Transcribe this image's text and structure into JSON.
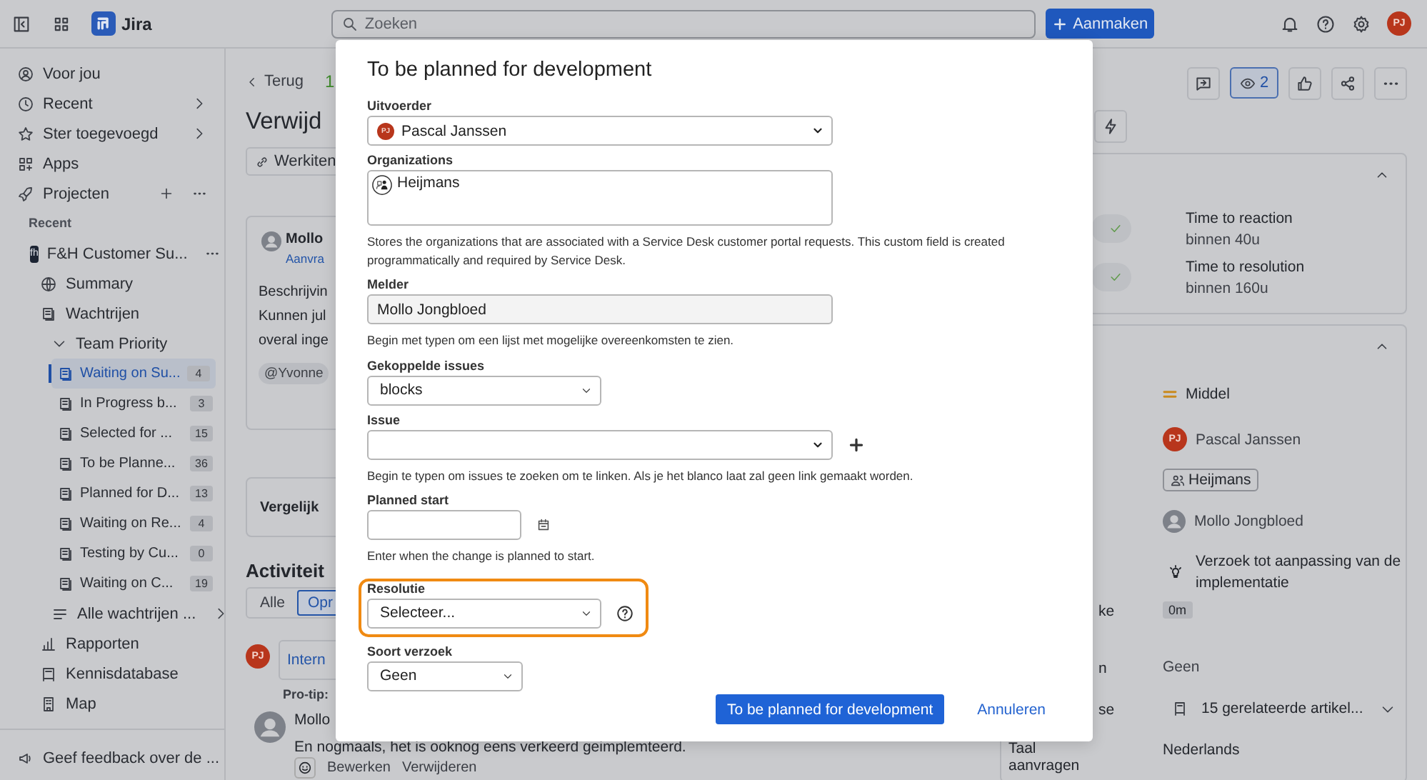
{
  "topbar": {
    "app_name": "Jira",
    "search": {
      "placeholder": "Zoeken"
    },
    "create_button": "Aanmaken",
    "avatar": "PJ"
  },
  "sidebar": {
    "top_items": [
      {
        "label": "Voor jou",
        "expandable": false
      },
      {
        "label": "Recent",
        "expandable": true
      },
      {
        "label": "Ster toegevoegd",
        "expandable": true
      },
      {
        "label": "Apps",
        "expandable": false
      }
    ],
    "projects": "Projecten",
    "section_label": "Recent",
    "project": {
      "logo": "fh",
      "name": "F&H Customer Su...",
      "children": [
        {
          "label": "Summary"
        },
        {
          "label": "Wachtrijen",
          "children": [
            {
              "label": "Team Priority",
              "expanded": true,
              "children": [
                {
                  "label": "Waiting on Su...",
                  "count": "4",
                  "selected": true
                },
                {
                  "label": "In Progress b...",
                  "count": "3",
                  "selected": false
                },
                {
                  "label": "Selected for ...",
                  "count": "15",
                  "selected": false
                },
                {
                  "label": "To be Planne...",
                  "count": "36",
                  "selected": false
                },
                {
                  "label": "Planned for D...",
                  "count": "13",
                  "selected": false
                },
                {
                  "label": "Waiting on Re...",
                  "count": "4",
                  "selected": false
                },
                {
                  "label": "Testing by Cu...",
                  "count": "0",
                  "selected": false
                },
                {
                  "label": "Waiting on C...",
                  "count": "19",
                  "selected": false
                }
              ]
            },
            {
              "label": "Alle wachtrijen ...",
              "expandable": true
            }
          ]
        },
        {
          "label": "Rapporten"
        },
        {
          "label": "Kennisdatabase"
        },
        {
          "label": "Map"
        }
      ]
    },
    "feedback": "Geef feedback over de ..."
  },
  "issue": {
    "back": "Terug",
    "status_fragment": "1",
    "title": "Verwijd",
    "link_button": "Werkiten",
    "description_card": {
      "author": "Mollo",
      "author_sub": "Aanvra",
      "heading": "Beschrijvin",
      "lines": [
        "Kunnen jul",
        "overal inge"
      ],
      "mention": "@Yvonne"
    },
    "similar_card": "Vergelijk",
    "activity": {
      "title": "Activiteit",
      "tabs": [
        {
          "label": "Alle",
          "selected": false
        },
        {
          "label": "Opr",
          "selected": true
        }
      ],
      "avatar": "PJ",
      "internal_note": "Intern",
      "protip": "Pro-tip:",
      "comments": [
        {
          "author": "Mollo",
          "text": "En nogmaals, het is ooknog eens verkeerd geimplemteerd.",
          "actions": [
            "Bewerken",
            "Verwijderen"
          ]
        }
      ]
    }
  },
  "details": {
    "watchers": "2",
    "sla": [
      {
        "name": "Time to reaction",
        "value": "binnen 40u"
      },
      {
        "name": "Time to resolution",
        "value": "binnen 160u"
      }
    ],
    "fields": [
      {
        "kind": "priority",
        "value": "Middel"
      },
      {
        "kind": "user",
        "avatar": "PJ",
        "value": "Pascal Janssen"
      },
      {
        "kind": "org",
        "value": "Heijmans"
      },
      {
        "kind": "person",
        "value": "Mollo Jongbloed"
      },
      {
        "kind": "request-type",
        "value": "Verzoek tot aanpassing van de implementatie"
      },
      {
        "kind": "time",
        "label_end": "ke",
        "value": "0m"
      },
      {
        "kind": "plain",
        "label_end": "n",
        "value": "Geen"
      },
      {
        "kind": "articles",
        "label_end": "se",
        "value": "15 gerelateerde artikel..."
      },
      {
        "kind": "plain",
        "label": "Taal aanvragen",
        "value": "Nederlands"
      }
    ]
  },
  "dialog": {
    "title": "To be planned for development",
    "fields": [
      {
        "kind": "user-select",
        "label": "Uitvoerder",
        "avatar": "PJ",
        "value": "Pascal Janssen"
      },
      {
        "kind": "tags",
        "label": "Organizations",
        "value": "Heijmans",
        "help": "Stores the organizations that are associated with a Service Desk customer portal requests. This custom field is created programmatically and required by Service Desk."
      },
      {
        "kind": "text",
        "label": "Melder",
        "value": "Mollo Jongbloed",
        "help": "Begin met typen om een lijst met mogelijke overeenkomsten te zien."
      },
      {
        "kind": "select",
        "label": "Gekoppelde issues",
        "value": "blocks"
      },
      {
        "kind": "issue-picker",
        "label": "Issue",
        "help": "Begin te typen om issues te zoeken om te linken. Als je het blanco laat zal geen link gemaakt worden."
      },
      {
        "kind": "date",
        "label": "Planned start",
        "help": "Enter when the change is planned to start."
      },
      {
        "kind": "select",
        "label": "Resolutie",
        "value": "Selecteer...",
        "highlighted": true,
        "help_icon": true
      },
      {
        "kind": "select",
        "label": "Soort verzoek",
        "value": "Geen"
      }
    ],
    "submit": "To be planned for development",
    "cancel": "Annuleren"
  }
}
